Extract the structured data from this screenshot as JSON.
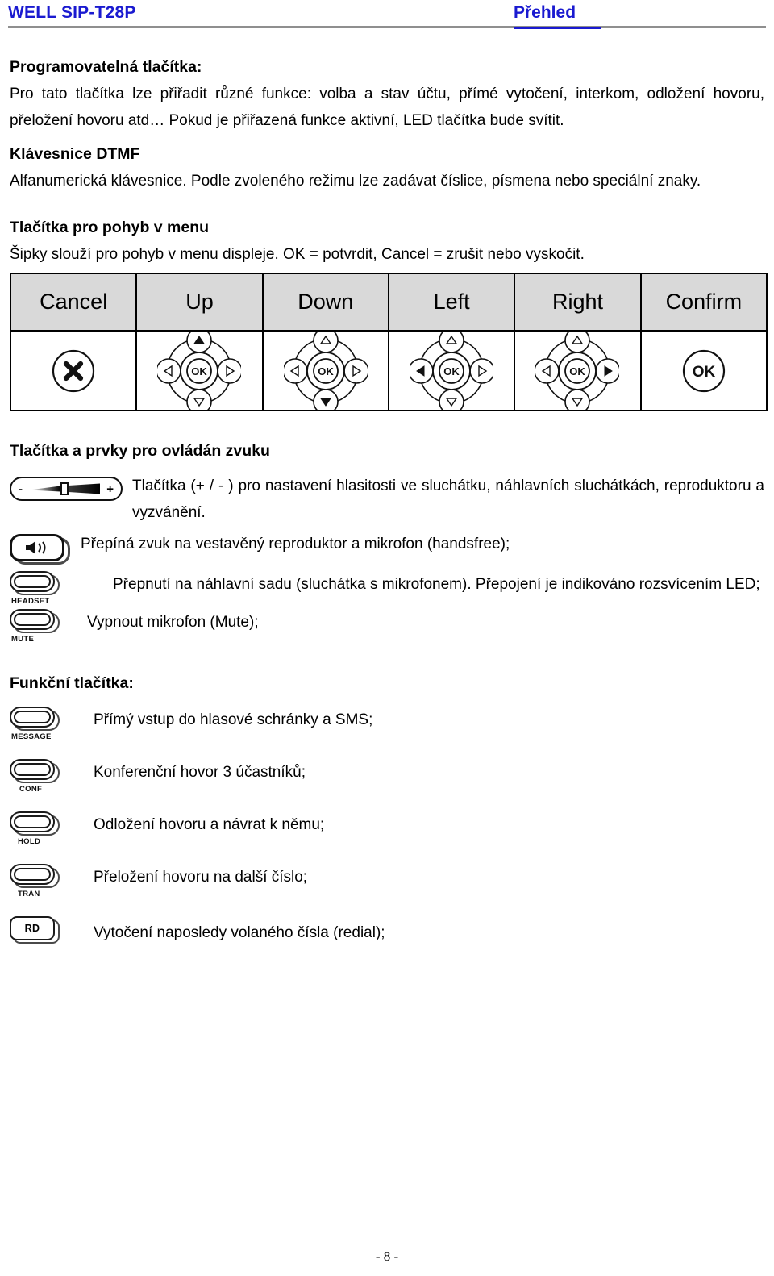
{
  "header": {
    "left_title": "WELL SIP-T28P",
    "right_title": "Přehled",
    "accent_color": "#1a1ad0",
    "rule_color": "#8f8f8f"
  },
  "sections": {
    "programmable": {
      "heading": "Programovatelná tlačítka:",
      "body": "Pro tato tlačítka lze přiřadit různé funkce: volba a stav účtu, přímé vytočení, interkom, odložení hovoru, přeložení hovoru atd… Pokud je přiřazená funkce aktivní, LED tlačítka bude svítit."
    },
    "dtmf": {
      "heading": "Klávesnice DTMF",
      "body": "Alfanumerická klávesnice. Podle zvoleného režimu lze zadávat číslice, písmena nebo speciální znaky."
    },
    "navigation": {
      "heading": "Tlačítka pro pohyb v menu",
      "body": "Šipky slouží pro pohyb v menu displeje. OK = potvrdit, Cancel = zrušit nebo vyskočit."
    },
    "audio": {
      "heading": "Tlačítka a prvky pro ovládán zvuku"
    },
    "function": {
      "heading": "Funkční tlačítka:"
    }
  },
  "nav_table": {
    "header_bg": "#d9d9d9",
    "columns": [
      {
        "label": "Cancel",
        "icon": "cancel-x-icon",
        "active": "none"
      },
      {
        "label": "Up",
        "icon": "dpad-icon",
        "active": "up"
      },
      {
        "label": "Down",
        "icon": "dpad-icon",
        "active": "down"
      },
      {
        "label": "Left",
        "icon": "dpad-icon",
        "active": "left"
      },
      {
        "label": "Right",
        "icon": "dpad-icon",
        "active": "right"
      },
      {
        "label": "Confirm",
        "icon": "ok-circle-icon",
        "active": "none"
      }
    ],
    "ok_label": "OK"
  },
  "audio_rows": [
    {
      "icon": "volume-rocker-icon",
      "minus": "-",
      "plus": "+",
      "text": "Tlačítka (+ / - ) pro nastavení hlasitosti ve sluchátku, náhlavních sluchátkách, reproduktoru a vyzvánění."
    },
    {
      "icon": "speaker-key-icon",
      "key_label": "",
      "text": "Přepíná zvuk na vestavěný reproduktor a mikrofon (handsfree);"
    },
    {
      "icon": "headset-key-icon",
      "key_label": "HEADSET",
      "text": "Přepnutí na náhlavní sadu (sluchátka s mikrofonem). Přepojení je indikováno rozsvícením LED;"
    },
    {
      "icon": "mute-key-icon",
      "key_label": "MUTE",
      "text": "Vypnout mikrofon (Mute);"
    }
  ],
  "function_rows": [
    {
      "icon": "message-key-icon",
      "key_label": "MESSAGE",
      "text": "Přímý vstup do hlasové schránky a SMS;"
    },
    {
      "icon": "conf-key-icon",
      "key_label": "CONF",
      "text": "Konferenční hovor 3 účastníků;"
    },
    {
      "icon": "hold-key-icon",
      "key_label": "HOLD",
      "text": "Odložení hovoru a návrat k němu;"
    },
    {
      "icon": "tran-key-icon",
      "key_label": "TRAN",
      "text": "Přeložení hovoru na další číslo;"
    },
    {
      "icon": "redial-key-icon",
      "key_label": "RD",
      "text": "Vytočení naposledy volaného čísla (redial);"
    }
  ],
  "footer": {
    "page_number": "- 8 -"
  }
}
